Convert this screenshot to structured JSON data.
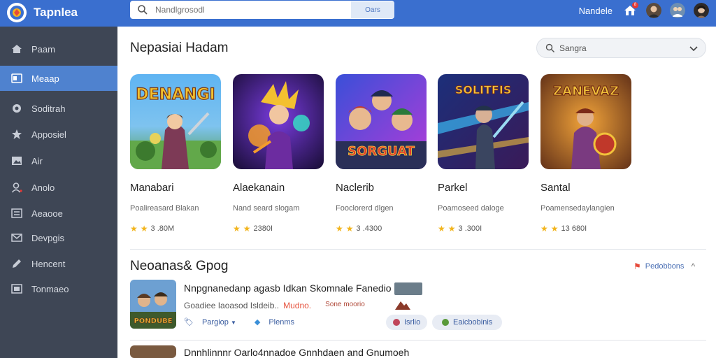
{
  "app": {
    "name": "Tapnlea"
  },
  "search": {
    "placeholder": "Nandlgrosodl",
    "button_label": "Oars"
  },
  "topbar": {
    "user_name": "Nandele",
    "notification_count": "8"
  },
  "sidebar": {
    "items": [
      {
        "label": "Paam",
        "icon": "home-icon"
      },
      {
        "label": "Meaap",
        "icon": "window-icon",
        "active": true
      },
      {
        "label": "Soditrah",
        "icon": "circle-icon"
      },
      {
        "label": "Apposiel",
        "icon": "star-icon"
      },
      {
        "label": "Air",
        "icon": "image-icon"
      },
      {
        "label": "Anolo",
        "icon": "user-icon"
      },
      {
        "label": "Aeaooe",
        "icon": "list-icon"
      },
      {
        "label": "Devpgis",
        "icon": "mail-icon"
      },
      {
        "label": "Hencent",
        "icon": "pen-icon"
      },
      {
        "label": "Tonmaeo",
        "icon": "box-icon"
      }
    ]
  },
  "featured": {
    "title": "Nepasiai Hadam",
    "sort": {
      "label": "Sangra"
    },
    "cards": [
      {
        "art_text": "DENANGI",
        "title": "Manabari",
        "subtitle": "Poalireasard Blakan",
        "rating": "3 .80M"
      },
      {
        "art_text": "",
        "title": "Alaekanain",
        "subtitle": "Nand seard slogam",
        "rating": "2380I"
      },
      {
        "art_text": "SORGUAT",
        "title": "Naclerib",
        "subtitle": "Fooclorerd dlgen",
        "rating": "3 .4300"
      },
      {
        "art_text": "SOLITFIS",
        "title": "Parkel",
        "subtitle": "Poamoseed daloge",
        "rating": "3 .300I"
      },
      {
        "art_text": "ZANEVAZ",
        "title": "Santal",
        "subtitle": "Poamensedaylangien",
        "rating": "13 680I"
      }
    ]
  },
  "list_section": {
    "title": "Neoanas& Gpog",
    "link_label": "Pedobbons",
    "items": [
      {
        "art_text": "PONDUBE",
        "title": "Nnpgnanedanp agasb Idkan Skomnale Fanedio",
        "meta_1": "Goadiee Iaoasod Isldeib..",
        "meta_accent": "Mudno.",
        "meta_muted": "Sone moorio",
        "action_1": "Pargiop",
        "action_2": "Plenms",
        "pill_1": "Isrlio",
        "pill_2": "Eaicbobinis"
      },
      {
        "title": "Dnnhlinnnr Oarlo4nnadoe Gnnhdaen and Gnumoeh"
      }
    ]
  },
  "colors": {
    "topbar": "#3a6fcf",
    "sidebar": "#3e4655",
    "sidebar_active": "#4f82cf",
    "star": "#f2b51e"
  }
}
